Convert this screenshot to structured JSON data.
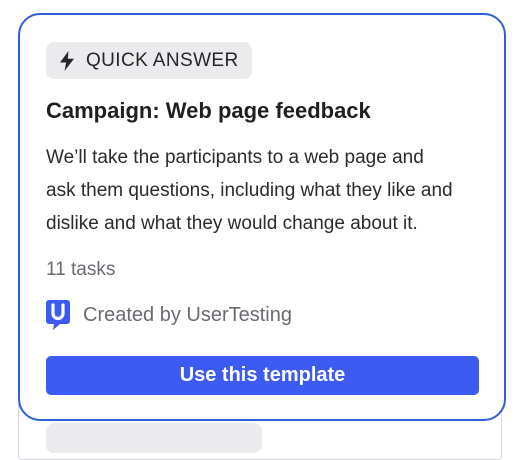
{
  "card": {
    "badge": {
      "icon": "lightning-bolt-icon",
      "label": "QUICK ANSWER"
    },
    "title": "Campaign: Web page feedback",
    "description": "We’ll take the participants to a web page and ask them questions, including what they like and dislike and what they would change about it.",
    "task_count": "11 tasks",
    "creator": {
      "logo": "usertesting-logo-icon",
      "text": "Created by UserTesting"
    },
    "cta_label": "Use this template"
  },
  "colors": {
    "card_border": "#2f5fd6",
    "badge_background": "#ebebed",
    "button_background": "#3b5bf2",
    "logo_blue": "#3b5bf2"
  }
}
